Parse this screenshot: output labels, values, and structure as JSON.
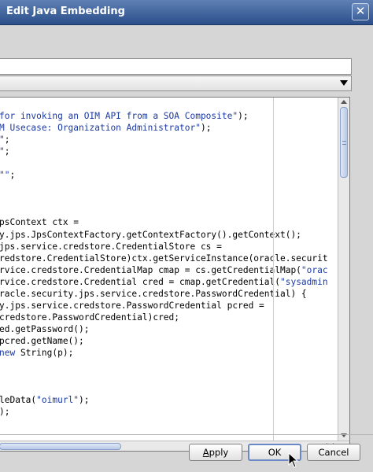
{
  "window": {
    "title": "Edit Java Embedding",
    "close_glyph": "✕"
  },
  "fields": {
    "text_value": "",
    "combo_value": ""
  },
  "editor": {
    "lines": [
      {
        "parts": [
          [
            "str",
            "for invoking an OIM API from a SOA Composite\""
          ],
          [
            "plain",
            ");"
          ]
        ]
      },
      {
        "parts": [
          [
            "str",
            "M Usecase: Organization Administrator\""
          ],
          [
            "plain",
            ");"
          ]
        ]
      },
      {
        "parts": [
          [
            "str",
            "\""
          ],
          [
            "plain",
            ";"
          ]
        ]
      },
      {
        "parts": [
          [
            "str",
            "\""
          ],
          [
            "plain",
            ";"
          ]
        ]
      },
      {
        "parts": [
          [
            "plain",
            ""
          ]
        ]
      },
      {
        "parts": [
          [
            "str",
            "\"\""
          ],
          [
            "plain",
            ";"
          ]
        ]
      },
      {
        "parts": [
          [
            "plain",
            ""
          ]
        ]
      },
      {
        "parts": [
          [
            "plain",
            ""
          ]
        ]
      },
      {
        "parts": [
          [
            "plain",
            ""
          ]
        ]
      },
      {
        "parts": [
          [
            "plain",
            "psContext ctx ="
          ]
        ]
      },
      {
        "parts": [
          [
            "plain",
            "y.jps.JpsContextFactory.getContextFactory().getContext();"
          ]
        ]
      },
      {
        "parts": [
          [
            "plain",
            "jps.service.credstore.CredentialStore cs ="
          ]
        ]
      },
      {
        "parts": [
          [
            "plain",
            "redstore.CredentialStore)ctx.getServiceInstance(oracle.securit"
          ]
        ]
      },
      {
        "parts": [
          [
            "plain",
            "rvice.credstore.CredentialMap cmap = cs.getCredentialMap("
          ],
          [
            "str",
            "\"orac"
          ]
        ]
      },
      {
        "parts": [
          [
            "plain",
            "rvice.credstore.Credential cred = cmap.getCredential("
          ],
          [
            "str",
            "\"sysadmin"
          ]
        ]
      },
      {
        "parts": [
          [
            "plain",
            "racle.security.jps.service.credstore.PasswordCredential) {"
          ]
        ]
      },
      {
        "parts": [
          [
            "plain",
            "y.jps.service.credstore.PasswordCredential pcred ="
          ]
        ]
      },
      {
        "parts": [
          [
            "plain",
            "credstore.PasswordCredential)cred;"
          ]
        ]
      },
      {
        "parts": [
          [
            "plain",
            "ed.getPassword();"
          ]
        ]
      },
      {
        "parts": [
          [
            "plain",
            "pcred.getName();"
          ]
        ]
      },
      {
        "parts": [
          [
            "kw",
            "new"
          ],
          [
            "plain",
            " String(p);"
          ]
        ]
      },
      {
        "parts": [
          [
            "plain",
            ""
          ]
        ]
      },
      {
        "parts": [
          [
            "plain",
            ""
          ]
        ]
      },
      {
        "parts": [
          [
            "plain",
            ""
          ]
        ]
      },
      {
        "parts": [
          [
            "plain",
            "leData("
          ],
          [
            "str",
            "\"oimurl\""
          ],
          [
            "plain",
            ");"
          ]
        ]
      },
      {
        "parts": [
          [
            "plain",
            ");"
          ]
        ]
      }
    ]
  },
  "buttons": {
    "apply": {
      "mnemonic": "A",
      "rest": "pply"
    },
    "ok": {
      "label": "OK"
    },
    "cancel": {
      "label": "Cancel"
    }
  }
}
